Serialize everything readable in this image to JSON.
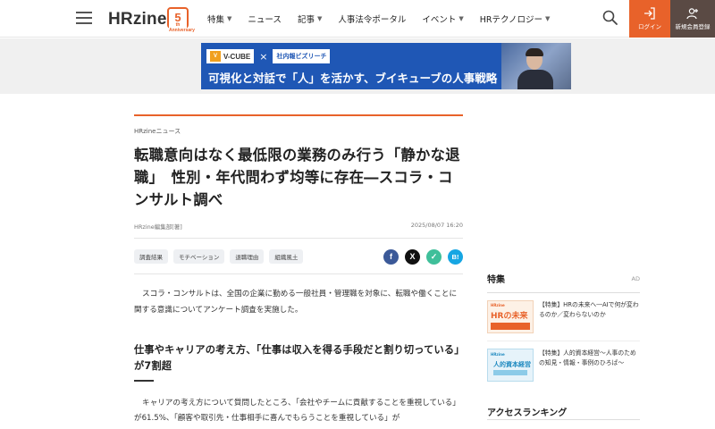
{
  "header": {
    "logo_text": "HRzine",
    "logo_badge": "5",
    "logo_badge_sub": "th Anniversary",
    "nav": [
      {
        "label": "特集",
        "has_dropdown": true
      },
      {
        "label": "ニュース",
        "has_dropdown": false
      },
      {
        "label": "記事",
        "has_dropdown": true
      },
      {
        "label": "人事法令ポータル",
        "has_dropdown": false
      },
      {
        "label": "イベント",
        "has_dropdown": true
      },
      {
        "label": "HRテクノロジー",
        "has_dropdown": true
      }
    ],
    "login_label": "ログイン",
    "register_label": "新規会員登録",
    "accent_color": "#e8622a",
    "register_color": "#5a4a44"
  },
  "banner": {
    "vcube_label": "V-CUBE",
    "vcube_mark": "V",
    "cross": "×",
    "partner_label": "社内報ビズリーチ",
    "text": "可視化と対話で「人」を活かす、ブイキューブの人事戦略",
    "color": "#1f57b5"
  },
  "article": {
    "category": "HRzineニュース",
    "title": "転職意向はなく最低限の業務のみ行う「静かな退職」　性別・年代問わず均等に存在―スコラ・コンサルト調べ",
    "author": "HRzine編集部[著]",
    "date": "2025/08/07 16:20",
    "tags": [
      "調査結果",
      "モチベーション",
      "退職理由",
      "組織風土"
    ],
    "share": [
      {
        "name": "facebook",
        "glyph": "f",
        "color": "#3b5998"
      },
      {
        "name": "x",
        "glyph": "X",
        "color": "#111111"
      },
      {
        "name": "line",
        "glyph": "✓",
        "color": "#3fbf9a"
      },
      {
        "name": "hatena",
        "glyph": "B!",
        "color": "#16a6e3"
      }
    ],
    "lead": "スコラ・コンサルトは、全国の企業に勤める一般社員・管理職を対象に、転職や働くことに関する意識についてアンケート調査を実施した。",
    "h2": "仕事やキャリアの考え方、「仕事は収入を得る手段だと割り切っている」が7割超",
    "body": "キャリアの考え方について質問したところ、「会社やチームに貢献することを重視している」が61.5%、「顧客や取引先・仕事相手に喜んでもらうことを重視している」が"
  },
  "sidebar": {
    "feature_title": "特集",
    "ad_label": "AD",
    "features": [
      {
        "text": "【特集】HRの未来へ―AIで何が変わるのか／変わらないのか",
        "thumb_top": "HRzine",
        "thumb_main": "HRの未来",
        "icon": "hr-future-thumbnail"
      },
      {
        "text": "【特集】人的資本経営～人事のための知見・情報・事例のひろば～",
        "thumb_top": "HRzine",
        "thumb_main": "人的資本経営",
        "icon": "human-capital-thumbnail"
      }
    ],
    "ranking_title": "アクセスランキング"
  }
}
